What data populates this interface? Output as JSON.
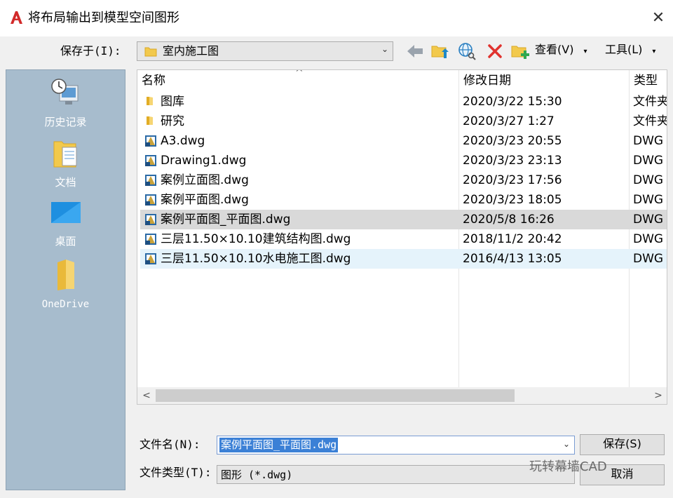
{
  "window": {
    "title": "将布局输出到模型空间图形",
    "close_glyph": "✕"
  },
  "save_in": {
    "label": "保存于(I):",
    "value": "室内施工图"
  },
  "toolbar": {
    "back": "back-arrow-icon",
    "up_folder": "folder-up-icon",
    "search_web": "search-web-icon",
    "delete": "delete-icon",
    "new_folder": "new-folder-icon",
    "view_label": "查看(V)",
    "tools_label": "工具(L)"
  },
  "places": [
    {
      "label": "历史记录",
      "icon": "history-icon"
    },
    {
      "label": "文档",
      "icon": "documents-icon"
    },
    {
      "label": "桌面",
      "icon": "desktop-icon"
    },
    {
      "label": "OneDrive",
      "icon": "onedrive-folder-icon"
    }
  ],
  "columns": {
    "name": "名称",
    "date": "修改日期",
    "type": "类型"
  },
  "files": [
    {
      "name": "图库",
      "date": "2020/3/22 15:30",
      "type": "文件夹",
      "kind": "folder"
    },
    {
      "name": "研究",
      "date": "2020/3/27 1:27",
      "type": "文件夹",
      "kind": "folder"
    },
    {
      "name": "A3.dwg",
      "date": "2020/3/23 20:55",
      "type": "DWG",
      "kind": "dwg"
    },
    {
      "name": "Drawing1.dwg",
      "date": "2020/3/23 23:13",
      "type": "DWG",
      "kind": "dwg"
    },
    {
      "name": "案例立面图.dwg",
      "date": "2020/3/23 17:56",
      "type": "DWG",
      "kind": "dwg"
    },
    {
      "name": "案例平面图.dwg",
      "date": "2020/3/23 18:05",
      "type": "DWG",
      "kind": "dwg"
    },
    {
      "name": "案例平面图_平面图.dwg",
      "date": "2020/5/8 16:26",
      "type": "DWG",
      "kind": "dwg",
      "state": "selected"
    },
    {
      "name": "三层11.50×10.10建筑结构图.dwg",
      "date": "2018/11/2 20:42",
      "type": "DWG",
      "kind": "dwg"
    },
    {
      "name": "三层11.50×10.10水电施工图.dwg",
      "date": "2016/4/13 13:05",
      "type": "DWG",
      "kind": "dwg",
      "state": "hover"
    }
  ],
  "filename": {
    "label": "文件名(N):",
    "value": "案例平面图_平面图.dwg"
  },
  "filetype": {
    "label": "文件类型(T):",
    "value": "图形 (*.dwg)"
  },
  "buttons": {
    "save": "保存(S)",
    "cancel": "取消"
  },
  "watermark": "玩转幕墙CAD",
  "colors": {
    "places_bg": "#a7bccd",
    "selection": "#3b80d6",
    "logo_red": "#d22a2a",
    "folder_yellow": "#f2c94c"
  }
}
